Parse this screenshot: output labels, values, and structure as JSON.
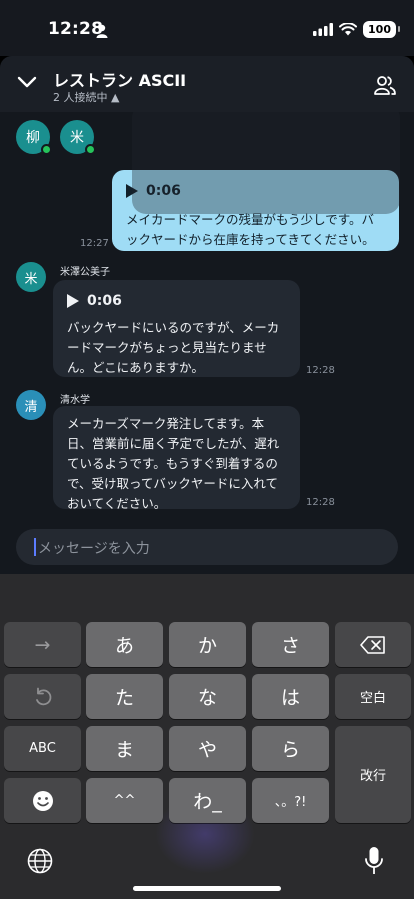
{
  "status": {
    "time": "12:28",
    "battery": "100"
  },
  "header": {
    "title": "レストラン ASCII",
    "subtitle": "2 人接続中 ▲"
  },
  "participants": [
    {
      "initial": "柳",
      "online": true
    },
    {
      "initial": "米",
      "online": true
    }
  ],
  "messages": [
    {
      "from": "me",
      "duration": "0:06",
      "text": "メイカードマークの残量がもう少しです。バックヤードから在庫を持ってきてください。",
      "time": "12:27"
    },
    {
      "from": "other",
      "initial": "米",
      "name": "米澤公美子",
      "duration": "0:06",
      "text": "バックヤードにいるのですが、メーカードマークがちょっと見当たりません。どこにありますか。",
      "time": "12:28"
    },
    {
      "from": "other",
      "initial": "清",
      "name": "清水学",
      "text": "メーカーズマーク発注してます。本日、営業前に届く予定でしたが、遅れているようです。もうすぐ到着するので、受け取ってバックヤードに入れておいてください。",
      "time": "12:28"
    }
  ],
  "composer": {
    "placeholder": "メッセージを入力"
  },
  "keyboard": {
    "row1": [
      "→",
      "あ",
      "か",
      "さ"
    ],
    "row2": [
      "た",
      "な",
      "は",
      "空白"
    ],
    "row3": [
      "ABC",
      "ま",
      "や",
      "ら",
      "改行"
    ],
    "row4": [
      "^^",
      "わ_",
      "、。?!"
    ]
  },
  "icons": [
    "person-icon",
    "signal-icon",
    "wifi-icon",
    "battery-icon",
    "chevron-down-icon",
    "members-icon",
    "play-icon",
    "undo-icon",
    "backspace-icon",
    "emoji-icon",
    "globe-icon",
    "mic-icon"
  ]
}
